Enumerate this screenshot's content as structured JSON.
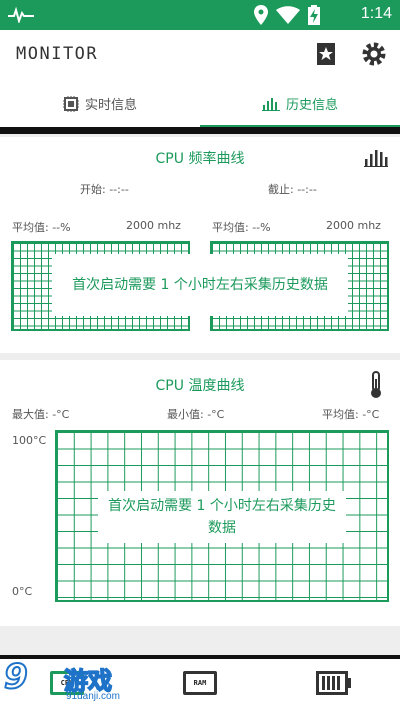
{
  "status_bar": {
    "time": "1:14"
  },
  "app": {
    "title": "MONITOR"
  },
  "tabs": [
    {
      "label": "实时信息",
      "selected": false,
      "icon": "chip-icon"
    },
    {
      "label": "历史信息",
      "selected": true,
      "icon": "bar-chart-icon"
    }
  ],
  "cpu_freq": {
    "title": "CPU 频率曲线",
    "start_label": "开始: --:--",
    "end_label": "截止: --:--",
    "left_avg": "平均值: --%",
    "left_max": "2000 mhz",
    "right_avg": "平均值: --%",
    "right_max": "2000 mhz",
    "notice": "首次启动需要 1 个小时左右采集历史数据"
  },
  "cpu_temp": {
    "title": "CPU 温度曲线",
    "max": "最大值: -°C",
    "min": "最小值: -°C",
    "avg": "平均值: -°C",
    "y_top": "100°C",
    "y_bottom": "0°C",
    "notice": "首次启动需要 1 个小时左右采集历史数据"
  },
  "bottom_nav": [
    {
      "label": "CPU",
      "icon": "cpu-chip-icon",
      "active": true
    },
    {
      "label": "RAM",
      "icon": "ram-chip-icon",
      "active": false
    },
    {
      "label": "",
      "icon": "battery-icon",
      "active": false
    }
  ],
  "watermark": {
    "logo": "9",
    "brand": "游戏",
    "site": "91danji.com"
  },
  "colors": {
    "accent": "#1c9a5c",
    "dark": "#111111"
  }
}
